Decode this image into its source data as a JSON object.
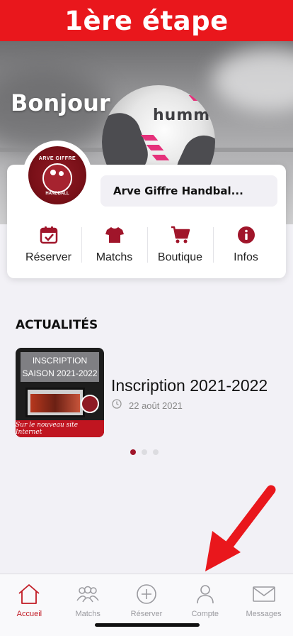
{
  "banner": {
    "text": "1ère étape",
    "color": "#e9171c"
  },
  "hero": {
    "greeting": "Bonjour",
    "ball_brand": "hummel"
  },
  "club": {
    "name": "Arve Giffre Handbal...",
    "logo_top_text": "ARVE GIFFRE",
    "logo_bottom_text": "HANDBALL"
  },
  "shortcuts": [
    {
      "label": "Réserver",
      "icon": "calendar-check-icon"
    },
    {
      "label": "Matchs",
      "icon": "jersey-icon"
    },
    {
      "label": "Boutique",
      "icon": "cart-icon"
    },
    {
      "label": "Infos",
      "icon": "info-icon"
    }
  ],
  "news_section": {
    "title": "ACTUALITÉS",
    "items": [
      {
        "title": "Inscription 2021-2022",
        "date": "22 août 2021",
        "thumb_line1": "INSCRIPTION",
        "thumb_line2": "SAISON 2021-2022",
        "thumb_footer": "Sur le nouveau site Internet"
      }
    ],
    "pagination": {
      "total": 3,
      "active": 1
    }
  },
  "tabbar": {
    "tabs": [
      {
        "label": "Accueil",
        "icon": "home-icon",
        "active": true
      },
      {
        "label": "Matchs",
        "icon": "users-icon",
        "active": false
      },
      {
        "label": "Réserver",
        "icon": "plus-circle-icon",
        "active": false
      },
      {
        "label": "Compte",
        "icon": "person-icon",
        "active": false
      },
      {
        "label": "Messages",
        "icon": "mail-icon",
        "active": false
      }
    ]
  },
  "colors": {
    "accent": "#a0152a",
    "active_tab": "#c11a24",
    "annotation_arrow": "#e9171c"
  }
}
